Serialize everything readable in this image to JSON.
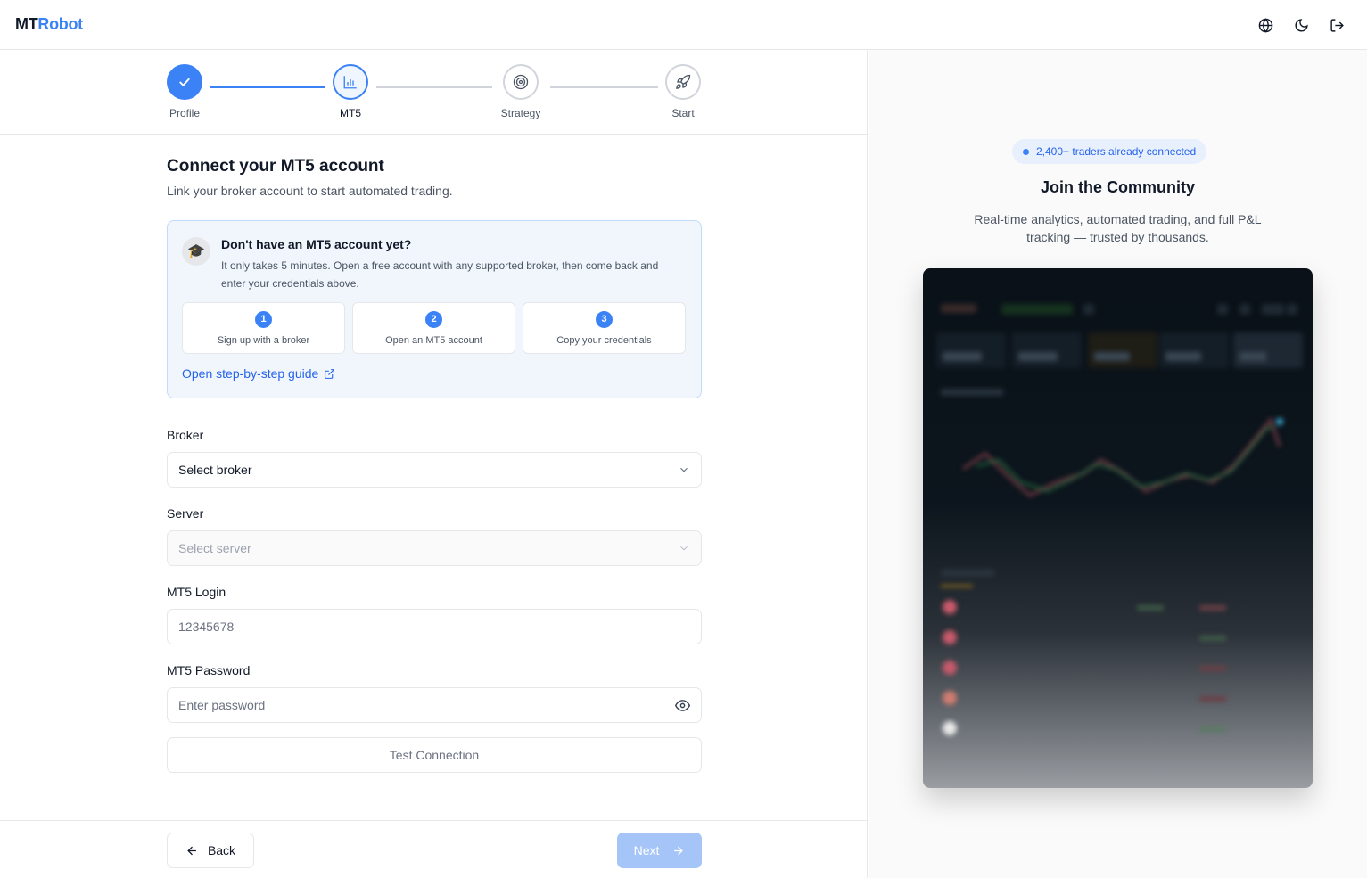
{
  "app": {
    "logo_mt": "MT",
    "logo_robot": "Robot"
  },
  "topbar": {
    "icons": [
      "globe-icon",
      "moon-icon",
      "logout-icon"
    ]
  },
  "stepper": {
    "steps": [
      {
        "label": "Profile",
        "state": "done"
      },
      {
        "label": "MT5",
        "state": "active"
      },
      {
        "label": "Strategy",
        "state": "pending"
      },
      {
        "label": "Start",
        "state": "pending"
      }
    ]
  },
  "form": {
    "title": "Connect your MT5 account",
    "subtitle": "Link your broker account to start automated trading.",
    "info": {
      "title": "Don't have an MT5 account yet?",
      "desc": "It only takes 5 minutes. Open a free account with any supported broker, then come back and enter your credentials above.",
      "steps": [
        {
          "num": "1",
          "label": "Sign up with a broker"
        },
        {
          "num": "2",
          "label": "Open an MT5 account"
        },
        {
          "num": "3",
          "label": "Copy your credentials"
        }
      ],
      "guide_link": "Open step-by-step guide"
    },
    "broker": {
      "label": "Broker",
      "value": "Select broker"
    },
    "server": {
      "label": "Server",
      "value": "Select server"
    },
    "login": {
      "label": "MT5 Login",
      "placeholder": "12345678"
    },
    "password": {
      "label": "MT5 Password",
      "placeholder": "Enter password"
    },
    "test_button": "Test Connection"
  },
  "footer": {
    "back": "Back",
    "next": "Next"
  },
  "community": {
    "badge": "2,400+ traders already connected",
    "title": "Join the Community",
    "subtitle": "Real-time analytics, automated trading, and full P&L tracking — trusted by thousands."
  },
  "colors": {
    "accent": "#3b82f6",
    "next_disabled": "#a5c5f9"
  }
}
